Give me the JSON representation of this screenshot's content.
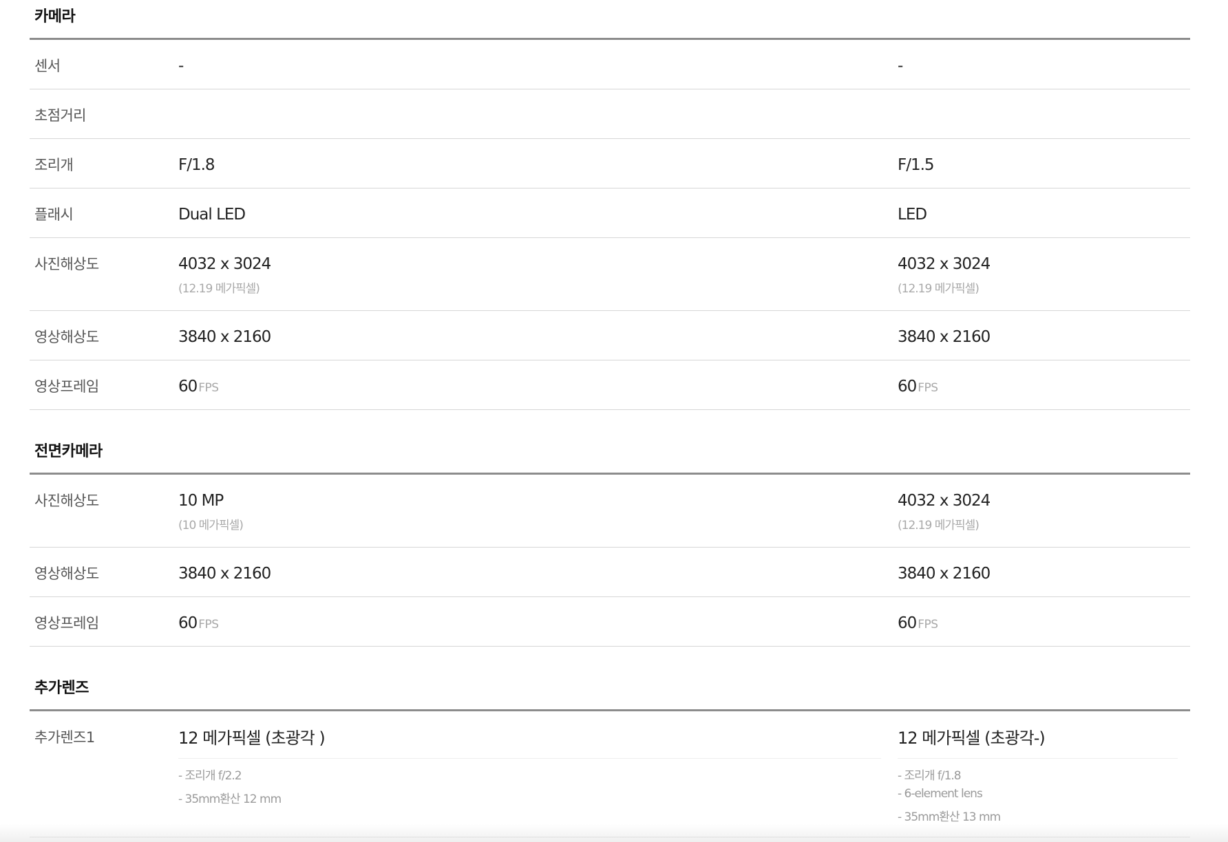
{
  "sections": {
    "camera": {
      "title": "카메라",
      "rows": {
        "sensor": {
          "label": "센서",
          "v1": "-",
          "v2": "-"
        },
        "focal": {
          "label": "초점거리",
          "v1": "",
          "v2": ""
        },
        "aperture": {
          "label": "조리개",
          "v1": "F/1.8",
          "v2": "F/1.5"
        },
        "flash": {
          "label": "플래시",
          "v1": "Dual LED",
          "v2": "LED"
        },
        "photo_res": {
          "label": "사진해상도",
          "v1": "4032 x 3024",
          "v1_sub": "(12.19 메가픽셀)",
          "v2": "4032 x 3024",
          "v2_sub": "(12.19 메가픽셀)"
        },
        "video_res": {
          "label": "영상해상도",
          "v1": "3840 x 2160",
          "v2": "3840 x 2160"
        },
        "video_fps": {
          "label": "영상프레임",
          "v1": "60",
          "v1_unit": "FPS",
          "v2": "60",
          "v2_unit": "FPS"
        }
      }
    },
    "front_camera": {
      "title": "전면카메라",
      "rows": {
        "photo_res": {
          "label": "사진해상도",
          "v1": "10 MP",
          "v1_sub": "(10 메가픽셀)",
          "v2": "4032 x 3024",
          "v2_sub": "(12.19 메가픽셀)"
        },
        "video_res": {
          "label": "영상해상도",
          "v1": "3840 x 2160",
          "v2": "3840 x 2160"
        },
        "video_fps": {
          "label": "영상프레임",
          "v1": "60",
          "v1_unit": "FPS",
          "v2": "60",
          "v2_unit": "FPS"
        }
      }
    },
    "extra_lens": {
      "title": "추가렌즈",
      "rows": {
        "lens1": {
          "label": "추가렌즈1",
          "v1_head": "12 메가픽셀 (초광각 )",
          "v1_notes": [
            "- 조리개 f/2.2",
            "- 35mm환산 12 mm"
          ],
          "v2_head": "12 메가픽셀 (초광각-)",
          "v2_notes": [
            "- 조리개 f/1.8",
            "- 6-element lens",
            "- 35mm환산 13 mm"
          ]
        }
      }
    }
  }
}
